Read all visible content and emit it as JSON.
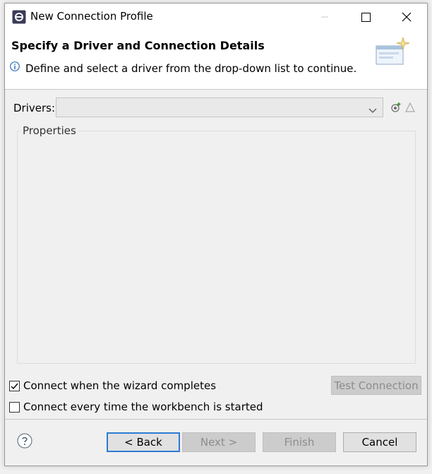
{
  "window": {
    "title": "New Connection Profile"
  },
  "header": {
    "title": "Specify a Driver and Connection Details",
    "description": "Define and select a driver from the drop-down list to continue."
  },
  "drivers": {
    "label": "Drivers:",
    "selected_value": ""
  },
  "properties": {
    "label": "Properties"
  },
  "options": {
    "connect_on_complete": {
      "label": "Connect when the wizard completes",
      "checked": true
    },
    "connect_on_startup": {
      "label": "Connect every time the workbench is started",
      "checked": false
    }
  },
  "buttons": {
    "test_connection": "Test Connection",
    "back": "< Back",
    "next": "Next >",
    "finish": "Finish",
    "cancel": "Cancel"
  },
  "icons": {
    "app": "eclipse-icon",
    "info": "info-icon",
    "new_driver": "new-driver-icon",
    "edit_driver": "edit-driver-icon",
    "help": "help-icon",
    "wizard_banner": "wizard-banner-icon"
  },
  "colors": {
    "accent": "#2e7bd2",
    "window_bg": "#f0f0f0",
    "disabled_button": "#cccccc",
    "disabled_text": "#8c8c8c"
  }
}
